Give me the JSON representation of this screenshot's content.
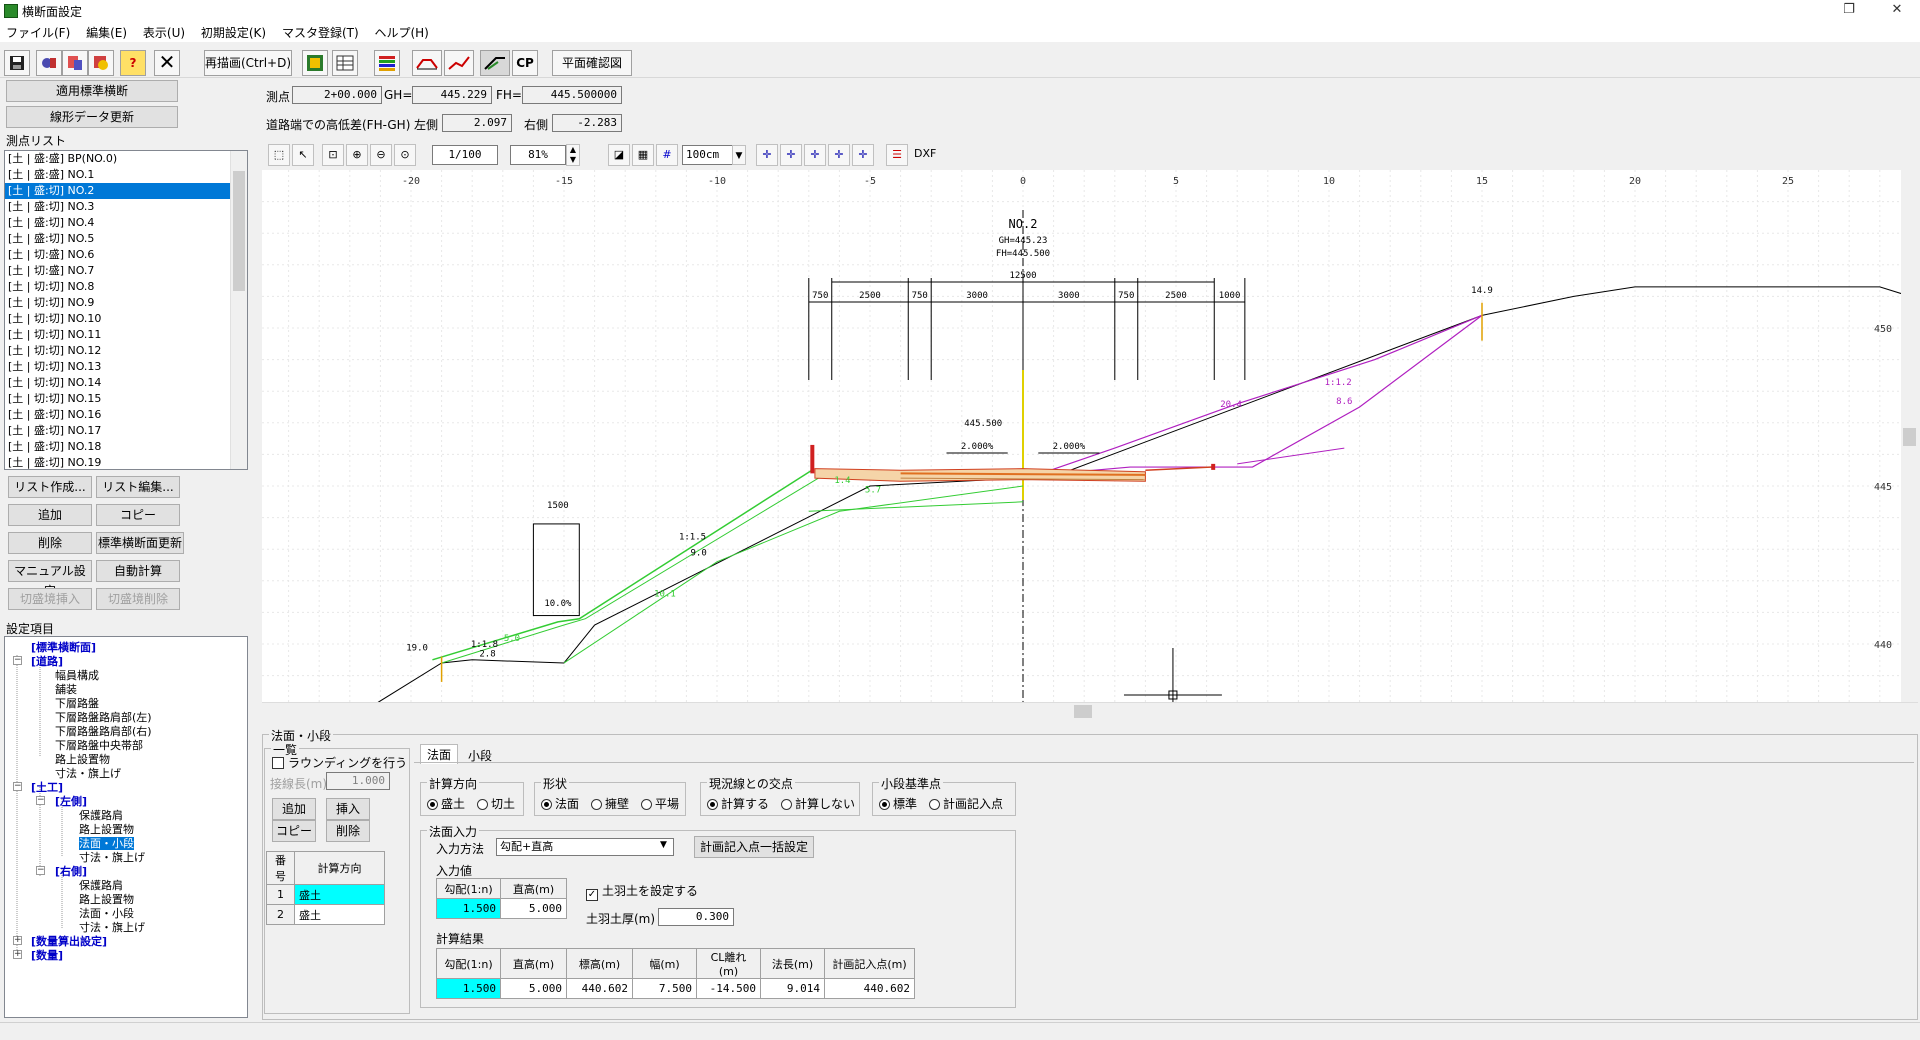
{
  "window": {
    "title": "横断面設定",
    "maximize": "❐",
    "close": "✕"
  },
  "menu": [
    "ファイル(F)",
    "編集(E)",
    "表示(U)",
    "初期設定(K)",
    "マスタ登録(T)",
    "ヘルプ(H)"
  ],
  "toolbar": {
    "redraw": "再描画(Ctrl+D)",
    "cp": "CP",
    "plan_check": "平面確認図",
    "help_mark": "?"
  },
  "left": {
    "apply_std": "適用標準横断",
    "update_line": "線形データ更新",
    "point_list_title": "測点リスト",
    "points": [
      "[土 | 盛:盛] BP(NO.0)",
      "[土 | 盛:盛] NO.1",
      "[土 | 盛:切] NO.2",
      "[土 | 盛:切] NO.3",
      "[土 | 盛:切] NO.4",
      "[土 | 盛:切] NO.5",
      "[土 | 切:盛] NO.6",
      "[土 | 切:盛] NO.7",
      "[土 | 切:切] NO.8",
      "[土 | 切:切] NO.9",
      "[土 | 切:切] NO.10",
      "[土 | 切:切] NO.11",
      "[土 | 切:切] NO.12",
      "[土 | 切:切] NO.13",
      "[土 | 切:切] NO.14",
      "[土 | 切:切] NO.15",
      "[土 | 盛:切] NO.16",
      "[土 | 盛:切] NO.17",
      "[土 | 盛:切] NO.18",
      "[土 | 盛:切] NO.19"
    ],
    "selected_point": 2,
    "buttons": {
      "make_list": "リスト作成...",
      "edit_list": "リスト編集...",
      "add": "追加",
      "copy": "コピー",
      "delete": "削除",
      "update_std": "標準横断面更新",
      "manual": "マニュアル設定",
      "auto": "自動計算",
      "cut_insert": "切盛境挿入",
      "cut_delete": "切盛境削除"
    },
    "settings_title": "設定項目",
    "tree": {
      "std": "[標準横断面]",
      "road": "[道路]",
      "width": "幅員構成",
      "pavement": "舗装",
      "lower": "下層路盤",
      "lower_left": "下層路盤路肩部(左)",
      "lower_right": "下層路盤路肩部(右)",
      "lower_center": "下層路盤中央帯部",
      "road_fixture": "路上設置物",
      "dim": "寸法・旗上げ",
      "earth": "[土工]",
      "left": "[左側]",
      "guard": "保護路肩",
      "fixture": "路上設置物",
      "slope": "法面・小段",
      "dim2": "寸法・旗上げ",
      "right": "[右側]",
      "guard_r": "保護路肩",
      "fixture_r": "路上設置物",
      "slope_r": "法面・小段",
      "dim_r": "寸法・旗上げ",
      "qty_set": "[数量算出設定]",
      "qty": "[数量]"
    }
  },
  "info": {
    "station_label": "測点",
    "station": "2+00.000",
    "gh_label": "GH=",
    "gh": "445.229",
    "fh_label": "FH=",
    "fh": "445.500000",
    "diff_label": "道路端での高低差(FH-GH)",
    "left_label": "左側",
    "left_val": "2.097",
    "right_label": "右側",
    "right_val": "-2.283"
  },
  "drawbar": {
    "scale": "1/100",
    "zoom": "81%",
    "grid": "100cm",
    "dxf": "DXF"
  },
  "chart_data": {
    "type": "cross-section",
    "x_ticks": [
      "-20",
      "-15",
      "-10",
      "-5",
      "0",
      "5",
      "10",
      "15",
      "20",
      "25"
    ],
    "y_ticks": [
      "450",
      "445",
      "440"
    ],
    "station": "NO.2",
    "gh_text": "GH=445.23",
    "fh_text": "FH=445.500",
    "dims": [
      "12500",
      "750",
      "2500",
      "750",
      "3000",
      "3000",
      "750",
      "2500",
      "1000"
    ],
    "elev": "445.500",
    "slope_l": "2.000%",
    "slope_r": "2.000%",
    "labels": [
      "14.9",
      "20.4",
      "1:1.2",
      "8.6",
      "1:1.5",
      "9.0",
      "10.1",
      "5.7",
      "1.4",
      "1500",
      "10.0%",
      "1:1.8",
      "2.8",
      "5.0",
      "19.0"
    ]
  },
  "panel": {
    "title": "法面・小段",
    "list_label": "一覧",
    "rounding": "ラウンディングを行う",
    "tangent_label": "接線長(m)",
    "tangent_val": "1.000",
    "add": "追加",
    "insert": "挿入",
    "copy": "コピー",
    "delete": "削除",
    "list_headers": [
      "番号",
      "計算方向"
    ],
    "rows": [
      [
        "1",
        "盛土"
      ],
      [
        "2",
        "盛土"
      ]
    ],
    "tab1": "法面",
    "tab2": "小段",
    "calc_dir": "計算方向",
    "fill": "盛土",
    "cut": "切土",
    "shape": "形状",
    "s1": "法面",
    "s2": "擁壁",
    "s3": "平場",
    "intersect": "現況線との交点",
    "calc": "計算する",
    "nocalc": "計算しない",
    "berm_base": "小段基準点",
    "std": "標準",
    "plan_pt": "計画記入点",
    "slope_input": "法面入力",
    "input_method": "入力方法",
    "method_val": "勾配+直高",
    "bulk_btn": "計画記入点一括設定",
    "input_val": "入力値",
    "h1": "勾配(1:n)",
    "h2": "直高(m)",
    "v1": "1.500",
    "v2": "5.000",
    "topsoil": "土羽土を設定する",
    "thick_label": "土羽土厚(m)",
    "thick": "0.300",
    "result": "計算結果",
    "rh": [
      "勾配(1:n)",
      "直高(m)",
      "標高(m)",
      "幅(m)",
      "CL離れ(m)",
      "法長(m)",
      "計画記入点(m)"
    ],
    "rv": [
      "1.500",
      "5.000",
      "440.602",
      "7.500",
      "-14.500",
      "9.014",
      "440.602"
    ]
  }
}
